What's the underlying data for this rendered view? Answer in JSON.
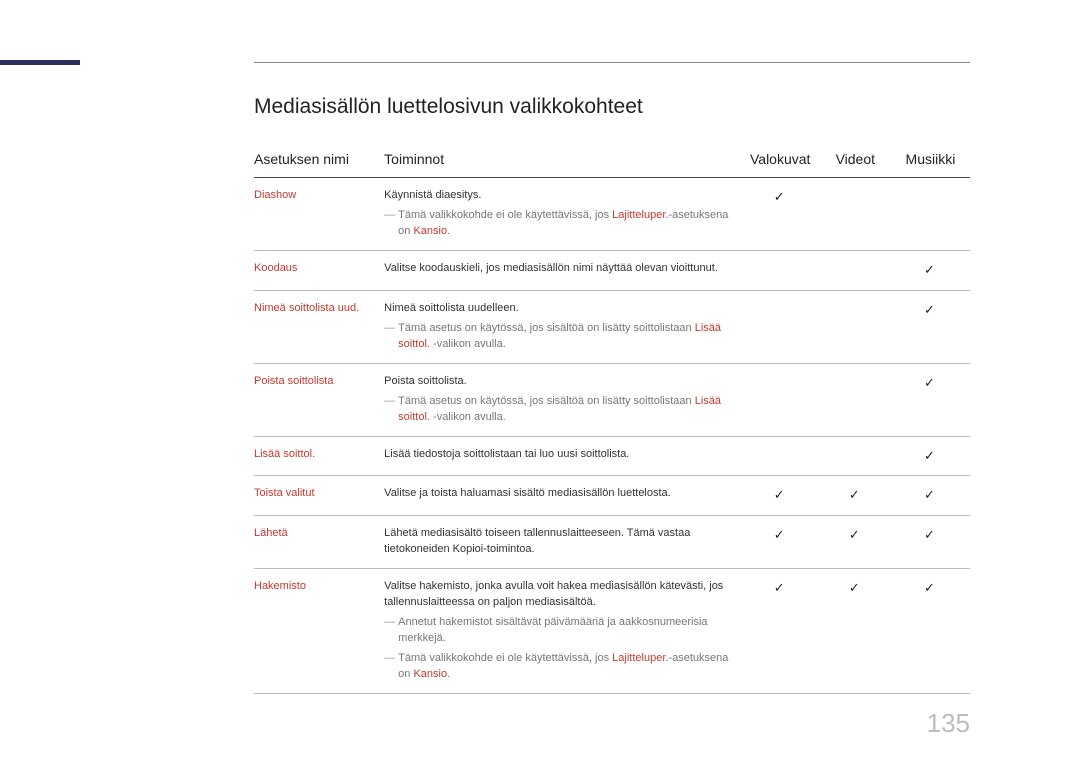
{
  "page_number": "135",
  "title": "Mediasisällön luettelosivun valikkokohteet",
  "checkmark": "✓",
  "headers": {
    "setting": "Asetuksen nimi",
    "actions": "Toiminnot",
    "photos": "Valokuvat",
    "videos": "Videot",
    "music": "Musiikki"
  },
  "rows": {
    "diashow": {
      "name": "Diashow",
      "desc": "Käynnistä diaesitys.",
      "note1a": "Tämä valikkokohde ei ole käytettävissä, jos ",
      "note1b": "Lajitteluper.",
      "note1c": "-asetuksena on ",
      "note1d": "Kansio",
      "note1e": "."
    },
    "koodaus": {
      "name": "Koodaus",
      "desc": "Valitse koodauskieli, jos mediasisällön nimi näyttää olevan vioittunut."
    },
    "nimea": {
      "name": "Nimeä soittolista uud.",
      "desc": "Nimeä soittolista uudelleen.",
      "note1a": "Tämä asetus on käytössä, jos sisältöä on lisätty soittolistaan ",
      "note1b": "Lisää soittol.",
      "note1c": " -valikon avulla."
    },
    "poista": {
      "name": "Poista soittolista",
      "desc": "Poista soittolista.",
      "note1a": "Tämä asetus on käytössä, jos sisältöä on lisätty soittolistaan ",
      "note1b": "Lisää soittol.",
      "note1c": " -valikon avulla."
    },
    "lisaa": {
      "name": "Lisää soittol.",
      "desc": "Lisää tiedostoja soittolistaan tai luo uusi soittolista."
    },
    "toista": {
      "name": "Toista valitut",
      "desc": "Valitse ja toista haluamasi sisältö mediasisällön luettelosta."
    },
    "laheta": {
      "name": "Lähetä",
      "desc": "Lähetä mediasisältö toiseen tallennuslaitteeseen. Tämä vastaa tietokoneiden Kopioi-toimintoa."
    },
    "hakemisto": {
      "name": "Hakemisto",
      "desc": "Valitse hakemisto, jonka avulla voit hakea mediasisällön kätevästi, jos tallennuslaitteessa on paljon mediasisältöä.",
      "note1": "Annetut hakemistot sisältävät päivämääriä ja aakkosnumeerisia merkkejä.",
      "note2a": "Tämä valikkokohde ei ole käytettävissä, jos ",
      "note2b": "Lajitteluper.",
      "note2c": "-asetuksena on ",
      "note2d": "Kansio",
      "note2e": "."
    }
  }
}
